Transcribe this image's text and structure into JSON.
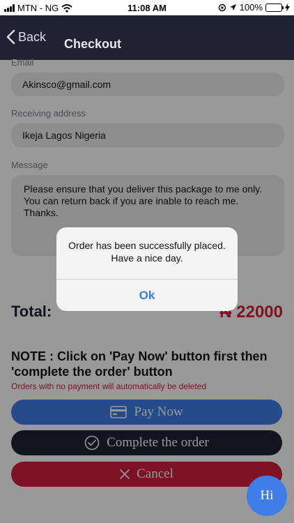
{
  "status_bar": {
    "carrier": "MTN - NG",
    "time": "11:08 AM",
    "battery": "100%"
  },
  "nav": {
    "back_label": "Back",
    "title": "Checkout"
  },
  "form": {
    "email_label": "Email",
    "email_value": "Akinsco@gmail.com",
    "address_label": "Receiving address",
    "address_value": "Ikeja Lagos Nigeria",
    "message_label": "Message",
    "message_value": "Please ensure that you deliver this package to me only. You can return back if you are inable to reach me. Thanks."
  },
  "total": {
    "label": "Total:",
    "value": "₦ 22000"
  },
  "note": {
    "text": "NOTE : Click on 'Pay Now' button first then 'complete the order' button",
    "warning": "Orders with no payment will automatically be deleted"
  },
  "buttons": {
    "pay_now": "Pay Now",
    "complete": "Complete the order",
    "cancel": "Cancel",
    "chat": "Hi"
  },
  "alert": {
    "line1": "Order has been successfully placed.",
    "line2": "Have a nice day.",
    "ok": "Ok"
  },
  "colors": {
    "navbar": "#1e2233",
    "accent_blue": "#3f7ee8",
    "accent_red": "#cf1f3b"
  },
  "icons": [
    "signal-icon",
    "wifi-icon",
    "location-icon",
    "battery-icon",
    "chevron-left-icon",
    "credit-card-icon",
    "check-circle-icon",
    "close-icon"
  ]
}
